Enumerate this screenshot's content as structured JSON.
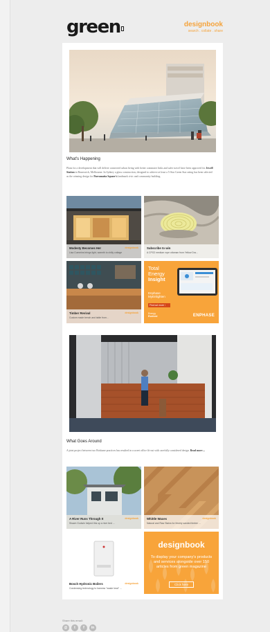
{
  "header": {
    "logo": "green",
    "brand": "designbook",
    "links": "search . collate . share"
  },
  "section1": {
    "title": "What's Happening",
    "para_a": "Plans for a development that will deliver connected urban living with better commuter links and safer travel have been approved for ",
    "para_b": "Jewell Station",
    "para_c": " in Brunswick, Melbourne. In Sydney a glass construction, designed to achieve at least a 5-Star Green Star rating has been selected as the winning design for ",
    "para_d": "Parramatta Square's",
    "para_e": " landmark civic and community building."
  },
  "tiles1": [
    {
      "title": "Modesty Becomes Her",
      "tag": "designbook",
      "desc": "Lisa Cummins brings light, warmth to chilly cottage"
    },
    {
      "title": "Subscribe to win",
      "tag": "",
      "desc": "A CPG2 medium rope ottoman from Yellow Dra..."
    },
    {
      "title": "Timber Revival",
      "tag": "designbook",
      "desc": "Custom made bench and table from..."
    }
  ],
  "enphase": {
    "title_1": "Total",
    "title_2": "Energy",
    "title_3": "Insight",
    "sub_1": "Enphase",
    "sub_2": "MyEnlighten",
    "button": "Find out more ›",
    "small_1": "Energy",
    "small_2": "Evolved",
    "logo": "ENPHASE"
  },
  "section2": {
    "title": "What Goes Around",
    "para": "A joint project between two Brisbane practices has resulted in a sweet office fit-out with carefully considered design.",
    "read_more": "Read more ..."
  },
  "tiles2": [
    {
      "title": "A River Runs Through It",
      "tag": "designbook",
      "desc": "Shawn Godwin helped this up a river bed ..."
    },
    {
      "title": "Whittle Waxes",
      "tag": "designbook",
      "desc": "Natural and Raw Stains for freshly sanded timber ..."
    },
    {
      "title": "Bosch Hydronic Boilers",
      "tag": "designbook",
      "desc": "Condensing technology to harness \"waste heat\" ..."
    }
  ],
  "db_ad": {
    "title": "designbook",
    "text": "To display your company's products and services alongside over 150 articles from green magazine",
    "button": "Click here"
  },
  "footer": {
    "share_label": "Share this email:",
    "icons": [
      "email-icon",
      "twitter-icon",
      "facebook-icon",
      "linkedin-icon"
    ],
    "icon_glyphs": [
      "@",
      "t",
      "f",
      "in"
    ]
  },
  "colors": {
    "accent": "#f5a33b",
    "orange_ad": "#f8a43a"
  }
}
